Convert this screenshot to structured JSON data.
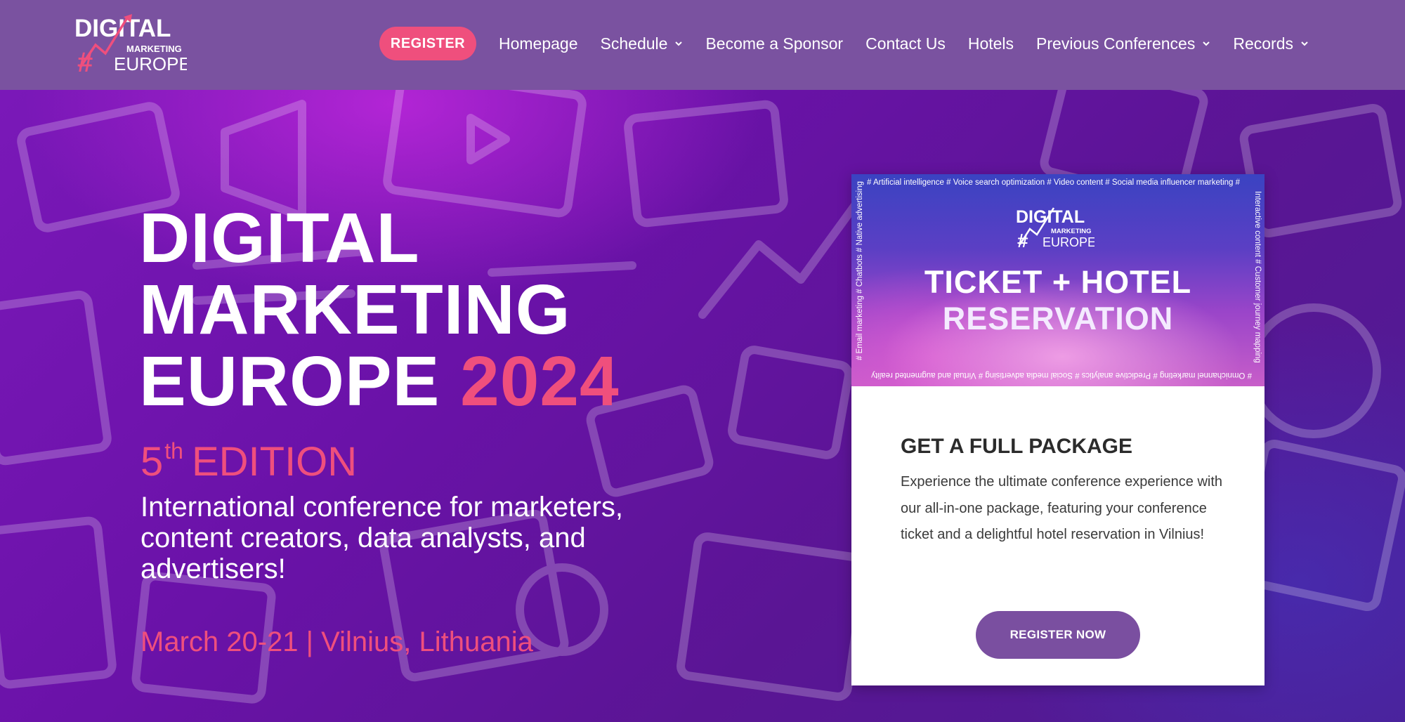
{
  "brand": {
    "logo_word1": "DIGITAL",
    "logo_word2": "MARKETING",
    "logo_word3": "EUROPE",
    "pink": "#ef4f7d",
    "purple_header": "#7a52a0"
  },
  "nav": {
    "register_label": "REGISTER",
    "items": [
      {
        "label": "Homepage",
        "has_dropdown": false
      },
      {
        "label": "Schedule",
        "has_dropdown": true
      },
      {
        "label": "Become a Sponsor",
        "has_dropdown": false
      },
      {
        "label": "Contact Us",
        "has_dropdown": false
      },
      {
        "label": "Hotels",
        "has_dropdown": false
      },
      {
        "label": "Previous Conferences",
        "has_dropdown": true
      },
      {
        "label": "Records",
        "has_dropdown": true
      }
    ]
  },
  "hero": {
    "title_line1": "DIGITAL",
    "title_line2": "MARKETING",
    "title_line3": "EUROPE",
    "title_year": "2024",
    "edition_number": "5",
    "edition_suffix": "th",
    "edition_word": "EDITION",
    "subtitle": "International conference for marketers, content creators, data analysts, and advertisers!",
    "dates": "March 20-21 | Vilnius, Lithuania"
  },
  "card": {
    "banner_tags_top": "# Artificial intelligence  # Voice search optimization  # Video content  # Social media influencer marketing  #",
    "banner_tags_left": "# Email marketing  # Chatbots  # Native advertising",
    "banner_tags_right": "Interactive content  # Customer journey mapping",
    "banner_tags_bottom": "# Omnichannel marketing  # Predictive analytics  # Social media advertising  # Virtual and augmented reality",
    "banner_title_line1": "TICKET + HOTEL",
    "banner_title_line2": "RESERVATION",
    "heading": "GET A FULL PACKAGE",
    "text": "Experience the ultimate conference experience with our all-in-one package, featuring your conference ticket and a delightful hotel reservation in Vilnius!",
    "button_label": "REGISTER NOW"
  }
}
